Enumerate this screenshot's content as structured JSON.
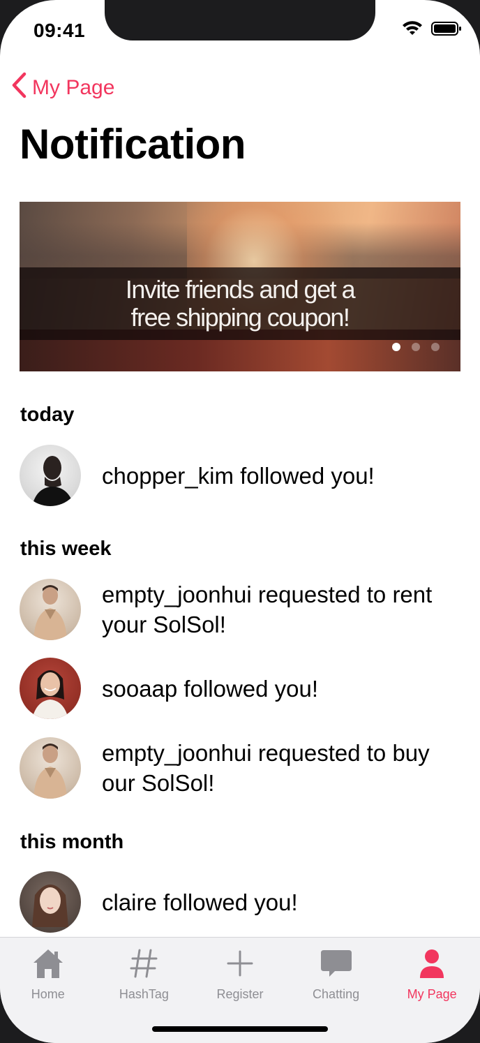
{
  "status": {
    "time": "09:41"
  },
  "nav": {
    "back_label": "My Page",
    "title": "Notification"
  },
  "banner": {
    "line1": "Invite friends and get a",
    "line2": "free shipping coupon!",
    "page_count": 3,
    "active_page": 0
  },
  "sections": {
    "today": {
      "header": "today",
      "items": [
        {
          "text": "chopper_kim followed you!"
        }
      ]
    },
    "this_week": {
      "header": "this week",
      "items": [
        {
          "text": "empty_joonhui requested to rent your SolSol!"
        },
        {
          "text": "sooaap followed you!"
        },
        {
          "text": "empty_joonhui requested to buy our SolSol!"
        }
      ]
    },
    "this_month": {
      "header": "this month",
      "items": [
        {
          "text": "claire followed you!"
        }
      ]
    }
  },
  "tabbar": {
    "items": [
      {
        "label": "Home",
        "icon": "home-icon"
      },
      {
        "label": "HashTag",
        "icon": "hashtag-icon"
      },
      {
        "label": "Register",
        "icon": "plus-icon"
      },
      {
        "label": "Chatting",
        "icon": "chat-bubble-icon"
      },
      {
        "label": "My Page",
        "icon": "person-icon"
      }
    ],
    "active_index": 4
  },
  "colors": {
    "accent": "#f2365e",
    "tab_inactive": "#8e8e93"
  }
}
